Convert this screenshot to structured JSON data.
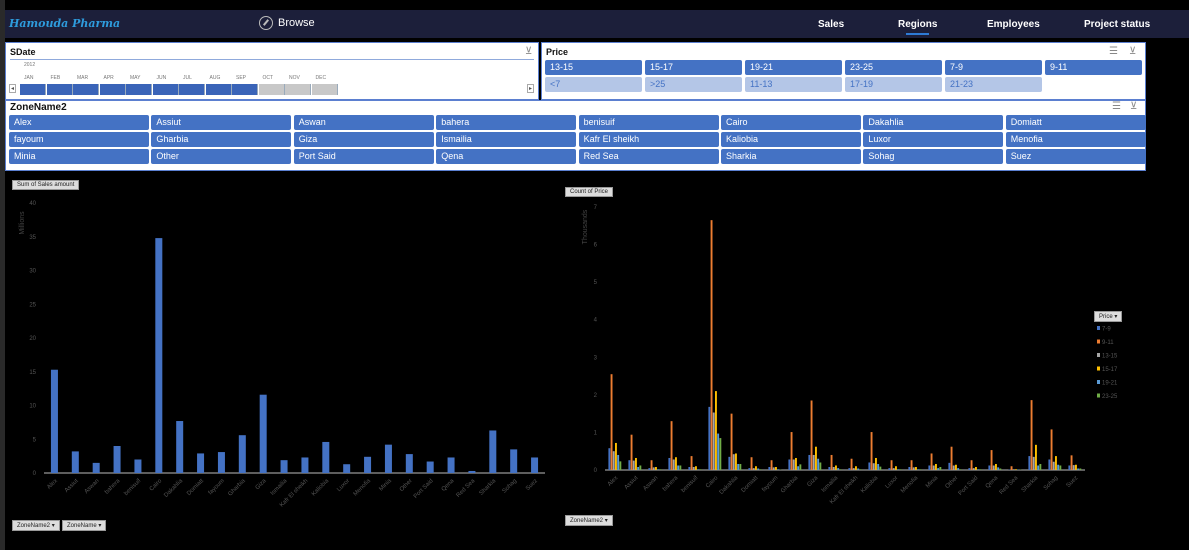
{
  "header": {
    "brand": "Hamouda Pharma",
    "browse": "Browse",
    "nav": [
      {
        "label": "Sales"
      },
      {
        "label": "Regions",
        "active": true
      },
      {
        "label": "Employees"
      },
      {
        "label": "Project status"
      }
    ]
  },
  "sdate": {
    "title": "SDate",
    "year": "2012",
    "months": [
      "JAN",
      "FEB",
      "MAR",
      "APR",
      "MAY",
      "JUN",
      "JUL",
      "AUG",
      "SEP",
      "OCT",
      "NOV",
      "DEC"
    ],
    "selected_through": 9
  },
  "price": {
    "title": "Price",
    "tiles": [
      {
        "label": "13-15",
        "on": true
      },
      {
        "label": "15-17",
        "on": true
      },
      {
        "label": "19-21",
        "on": true
      },
      {
        "label": "23-25",
        "on": true
      },
      {
        "label": "7-9",
        "on": true
      },
      {
        "label": "9-11",
        "on": true
      },
      {
        "label": "<7",
        "on": false
      },
      {
        "label": ">25",
        "on": false
      },
      {
        "label": "11-13",
        "on": false
      },
      {
        "label": "17-19",
        "on": false
      },
      {
        "label": "21-23",
        "on": false
      }
    ]
  },
  "zone": {
    "title": "ZoneName2",
    "tiles": [
      "Alex",
      "Assiut",
      "Aswan",
      "bahera",
      "benisuif",
      "Cairo",
      "Dakahlia",
      "Domiatt",
      "fayoum",
      "Gharbia",
      "Giza",
      "Ismailia",
      "Kafr El sheikh",
      "Kaliobia",
      "Luxor",
      "Menofia",
      "Minia",
      "Other",
      "Port Said",
      "Qena",
      "Red Sea",
      "Sharkia",
      "Sohag",
      "Suez"
    ]
  },
  "chart_data": [
    {
      "type": "bar",
      "title": "Sum of Sales amount",
      "ylabel": "Millions",
      "ylim": [
        0,
        40
      ],
      "yticks": [
        0,
        5,
        10,
        15,
        20,
        25,
        30,
        35,
        40
      ],
      "categories": [
        "Alex",
        "Assiut",
        "Aswan",
        "bahera",
        "benisuif",
        "Cairo",
        "Dakahlia",
        "Domiatt",
        "fayoum",
        "Gharbia",
        "Giza",
        "Ismailia",
        "Kafr El sheikh",
        "Kaliobia",
        "Luxor",
        "Menofia",
        "Minia",
        "Other",
        "Port Said",
        "Qena",
        "Red Sea",
        "Sharkia",
        "Sohag",
        "Suez"
      ],
      "values": [
        15.3,
        3.2,
        1.5,
        4,
        2,
        34.8,
        7.7,
        2.9,
        3.1,
        5.6,
        11.6,
        1.9,
        2.3,
        4.6,
        1.3,
        2.4,
        4.2,
        2.8,
        1.7,
        2.3,
        0.3,
        6.3,
        3.5,
        2.3
      ],
      "color": "#4472c4",
      "filters": [
        "ZoneName2",
        "ZoneName"
      ]
    },
    {
      "type": "bar",
      "title": "Count of Price",
      "ylabel": "Thousands",
      "ylim": [
        0,
        7
      ],
      "yticks": [
        0,
        1,
        2,
        3,
        4,
        5,
        6,
        7
      ],
      "legend_title": "Price",
      "legend": "right",
      "categories": [
        "Alex",
        "Assiut",
        "Aswan",
        "bahera",
        "benisuif",
        "Cairo",
        "Dakahlia",
        "Domiatt",
        "fayoum",
        "Gharbia",
        "Giza",
        "Ismailia",
        "Kafr El sheikh",
        "Kaliobia",
        "Luxor",
        "Menofia",
        "Minia",
        "Other",
        "Port Said",
        "Qena",
        "Red Sea",
        "Sharkia",
        "Sohag",
        "Suez"
      ],
      "series": [
        {
          "name": "7-9",
          "color": "#4472c4",
          "values": [
            0.58,
            0.26,
            0.05,
            0.32,
            0.08,
            1.68,
            0.35,
            0.05,
            0.08,
            0.28,
            0.4,
            0.08,
            0.05,
            0.2,
            0.05,
            0.08,
            0.12,
            0.19,
            0.05,
            0.12,
            0.01,
            0.37,
            0.28,
            0.12
          ]
        },
        {
          "name": "9-11",
          "color": "#ed7d31",
          "values": [
            2.55,
            0.94,
            0.26,
            1.3,
            0.37,
            6.65,
            1.5,
            0.34,
            0.26,
            1.01,
            1.85,
            0.4,
            0.3,
            1.01,
            0.26,
            0.26,
            0.44,
            0.62,
            0.26,
            0.53,
            0.1,
            1.86,
            1.08,
            0.39
          ]
        },
        {
          "name": "13-15",
          "color": "#a5a5a5",
          "values": [
            0.5,
            0.25,
            0.07,
            0.28,
            0.08,
            1.53,
            0.42,
            0.05,
            0.07,
            0.28,
            0.4,
            0.08,
            0.05,
            0.18,
            0.05,
            0.07,
            0.12,
            0.12,
            0.05,
            0.12,
            0.02,
            0.35,
            0.22,
            0.13
          ]
        },
        {
          "name": "15-17",
          "color": "#ffc000",
          "values": [
            0.72,
            0.32,
            0.08,
            0.34,
            0.1,
            2.1,
            0.44,
            0.1,
            0.08,
            0.32,
            0.62,
            0.12,
            0.1,
            0.32,
            0.1,
            0.08,
            0.16,
            0.14,
            0.08,
            0.16,
            0.02,
            0.67,
            0.37,
            0.14
          ]
        },
        {
          "name": "19-21",
          "color": "#5b9bd5",
          "values": [
            0.4,
            0.08,
            0.02,
            0.12,
            0.02,
            0.97,
            0.16,
            0.04,
            0.02,
            0.1,
            0.3,
            0.05,
            0.04,
            0.16,
            0.02,
            0.02,
            0.05,
            0.05,
            0.02,
            0.07,
            0.01,
            0.12,
            0.14,
            0.04
          ]
        },
        {
          "name": "23-25",
          "color": "#70ad47",
          "values": [
            0.23,
            0.12,
            0.02,
            0.12,
            0.02,
            0.85,
            0.16,
            0.02,
            0.01,
            0.15,
            0.2,
            0.02,
            0.02,
            0.09,
            0.02,
            0.02,
            0.08,
            0.02,
            0.02,
            0.04,
            0.01,
            0.16,
            0.12,
            0.04
          ]
        }
      ],
      "filters": [
        "ZoneName2"
      ]
    }
  ]
}
